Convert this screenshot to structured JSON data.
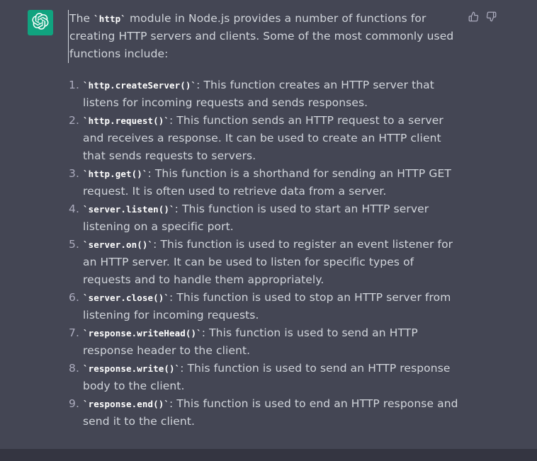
{
  "message": {
    "intro": {
      "before": "The ",
      "code": "`http`",
      "after": " module in Node.js provides a number of functions for creating HTTP servers and clients. Some of the most commonly used functions include:"
    },
    "items": [
      {
        "num": "1.",
        "code": "`http.createServer()`",
        "text": ": This function creates an HTTP server that listens for incoming requests and sends responses."
      },
      {
        "num": "2.",
        "code": "`http.request()`",
        "text": ": This function sends an HTTP request to a server and receives a response. It can be used to create an HTTP client that sends requests to servers."
      },
      {
        "num": "3.",
        "code": "`http.get()`",
        "text": ": This function is a shorthand for sending an HTTP GET request. It is often used to retrieve data from a server."
      },
      {
        "num": "4.",
        "code": "`server.listen()`",
        "text": ": This function is used to start an HTTP server listening on a specific port."
      },
      {
        "num": "5.",
        "code": "`server.on()`",
        "text": ": This function is used to register an event listener for an HTTP server. It can be used to listen for specific types of requests and to handle them appropriately."
      },
      {
        "num": "6.",
        "code": "`server.close()`",
        "text": ": This function is used to stop an HTTP server from listening for incoming requests."
      },
      {
        "num": "7.",
        "code": "`response.writeHead()`",
        "text": ": This function is used to send an HTTP response header to the client."
      },
      {
        "num": "8.",
        "code": "`response.write()`",
        "text": ": This function is used to send an HTTP response body to the client."
      },
      {
        "num": "9.",
        "code": "`response.end()`",
        "text": ": This function is used to end an HTTP response and send it to the client."
      }
    ]
  },
  "icons": {
    "avatar": "openai-logo-icon",
    "thumbs_up": "thumbs-up-icon",
    "thumbs_down": "thumbs-down-icon"
  },
  "colors": {
    "background": "#444654",
    "avatar_bg": "#10a37f",
    "text": "#d1d5db",
    "bottom_bar": "#343541"
  }
}
